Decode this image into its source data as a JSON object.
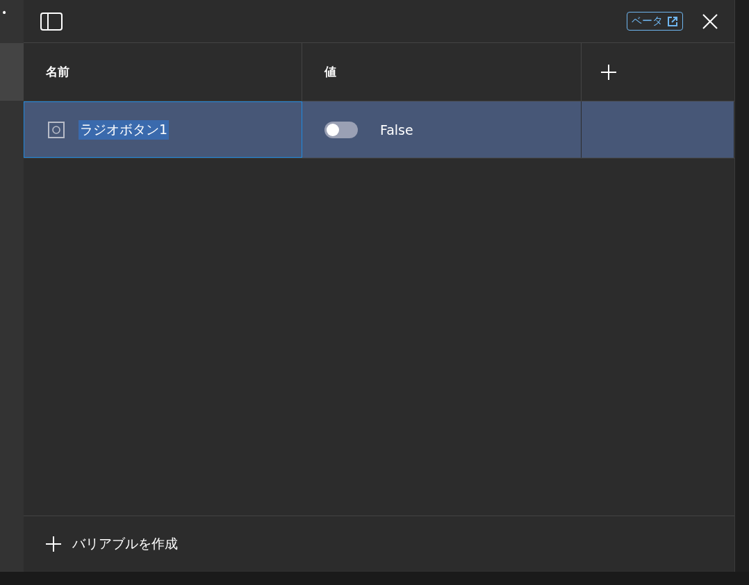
{
  "left_strip": {
    "text": "•"
  },
  "header": {
    "beta_badge": "ベータ"
  },
  "table": {
    "columns": [
      {
        "label": "名前"
      },
      {
        "label": "値"
      }
    ],
    "rows": [
      {
        "name": "ラジオボタン1",
        "selected": true,
        "value": {
          "on": false,
          "label": "False"
        }
      }
    ]
  },
  "footer": {
    "create_button": "バリアブルを作成"
  }
}
